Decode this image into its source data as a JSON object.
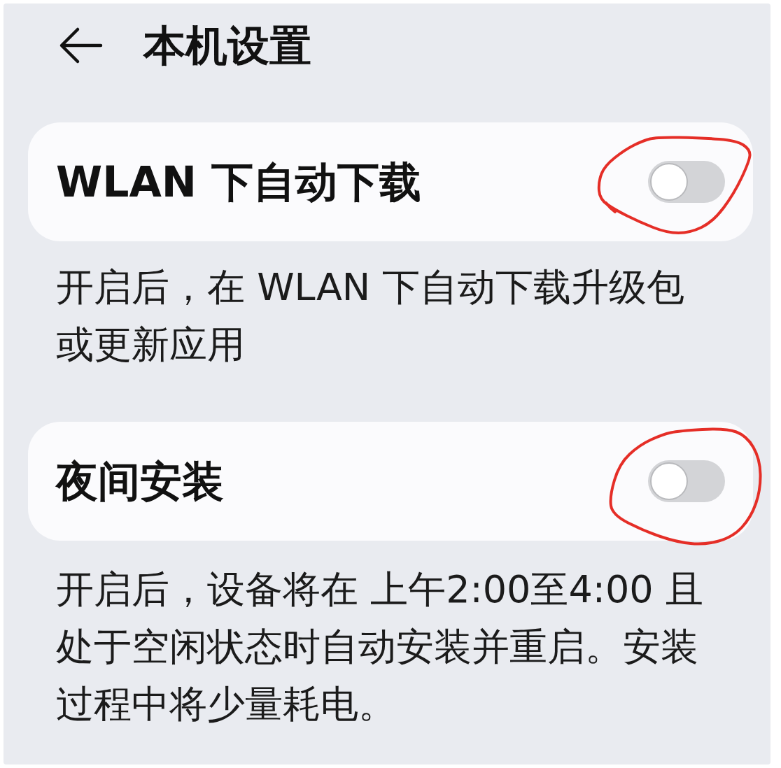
{
  "header": {
    "title": "本机设置"
  },
  "settings": [
    {
      "label": "WLAN 下自动下载",
      "on": false,
      "circled": true,
      "description": "开启后，在 WLAN 下自动下载升级包或更新应用"
    },
    {
      "label": "夜间安装",
      "on": false,
      "circled": true,
      "description": "开启后，设备将在 上午2:00至4:00 且处于空闲状态时自动安装并重启。安装过程中将少量耗电。"
    }
  ]
}
